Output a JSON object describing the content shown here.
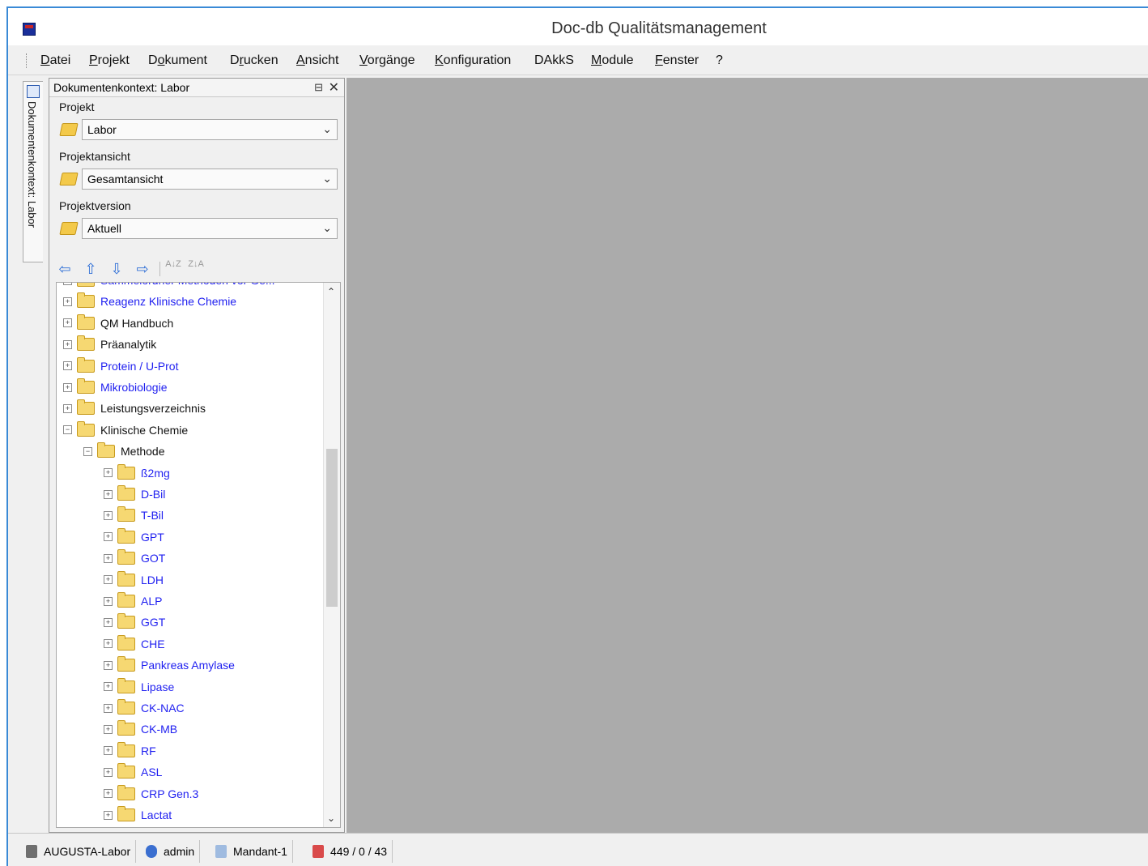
{
  "window": {
    "title": "Doc-db Qualitätsmanagement"
  },
  "menu": [
    {
      "pre": "",
      "mn": "D",
      "post": "atei"
    },
    {
      "pre": "",
      "mn": "P",
      "post": "rojekt"
    },
    {
      "pre": "D",
      "mn": "o",
      "post": "kument"
    },
    {
      "pre": "D",
      "mn": "r",
      "post": "ucken"
    },
    {
      "pre": "",
      "mn": "A",
      "post": "nsicht"
    },
    {
      "pre": "",
      "mn": "V",
      "post": "orgänge"
    },
    {
      "pre": "",
      "mn": "K",
      "post": "onfiguration"
    },
    {
      "pre": "DAkkS",
      "mn": "",
      "post": ""
    },
    {
      "pre": "",
      "mn": "M",
      "post": "odule"
    },
    {
      "pre": "",
      "mn": "F",
      "post": "enster"
    },
    {
      "pre": "?",
      "mn": "",
      "post": ""
    }
  ],
  "side_tab": {
    "label": "Dokumentenkontext: Labor"
  },
  "panel": {
    "title": "Dokumentenkontext: Labor",
    "pin_glyph": "⊟",
    "close_glyph": "✕",
    "projekt": {
      "label": "Projekt",
      "value": "Labor"
    },
    "ansicht": {
      "label": "Projektansicht",
      "value": "Gesamtansicht"
    },
    "version": {
      "label": "Projektversion",
      "value": "Aktuell"
    },
    "toolbar": {
      "back": "⇦",
      "up": "⇧",
      "down": "⇩",
      "forward": "⇨",
      "sort_az": "A↓Z",
      "sort_za": "Z↓A"
    }
  },
  "tree": [
    {
      "label": "Sammelordner Methoden vor Ge...",
      "level": 0,
      "expanded": false,
      "color": "blue"
    },
    {
      "label": "Reagenz Klinische Chemie",
      "level": 0,
      "expanded": false,
      "color": "blue"
    },
    {
      "label": "QM Handbuch",
      "level": 0,
      "expanded": false,
      "color": "dark"
    },
    {
      "label": "Präanalytik",
      "level": 0,
      "expanded": false,
      "color": "dark"
    },
    {
      "label": "Protein / U-Prot",
      "level": 0,
      "expanded": false,
      "color": "blue"
    },
    {
      "label": "Mikrobiologie",
      "level": 0,
      "expanded": false,
      "color": "blue"
    },
    {
      "label": "Leistungsverzeichnis",
      "level": 0,
      "expanded": false,
      "color": "dark"
    },
    {
      "label": "Klinische Chemie",
      "level": 0,
      "expanded": true,
      "color": "dark"
    },
    {
      "label": "Methode",
      "level": 1,
      "expanded": true,
      "color": "dark"
    },
    {
      "label": "ß2mg",
      "level": 2,
      "expanded": false,
      "color": "blue"
    },
    {
      "label": "D-Bil",
      "level": 2,
      "expanded": false,
      "color": "blue"
    },
    {
      "label": "T-Bil",
      "level": 2,
      "expanded": false,
      "color": "blue"
    },
    {
      "label": "GPT",
      "level": 2,
      "expanded": false,
      "color": "blue"
    },
    {
      "label": "GOT",
      "level": 2,
      "expanded": false,
      "color": "blue"
    },
    {
      "label": "LDH",
      "level": 2,
      "expanded": false,
      "color": "blue"
    },
    {
      "label": "ALP",
      "level": 2,
      "expanded": false,
      "color": "blue"
    },
    {
      "label": "GGT",
      "level": 2,
      "expanded": false,
      "color": "blue"
    },
    {
      "label": "CHE",
      "level": 2,
      "expanded": false,
      "color": "blue"
    },
    {
      "label": "Pankreas Amylase",
      "level": 2,
      "expanded": false,
      "color": "blue"
    },
    {
      "label": "Lipase",
      "level": 2,
      "expanded": false,
      "color": "blue"
    },
    {
      "label": "CK-NAC",
      "level": 2,
      "expanded": false,
      "color": "blue"
    },
    {
      "label": "CK-MB",
      "level": 2,
      "expanded": false,
      "color": "blue"
    },
    {
      "label": "RF",
      "level": 2,
      "expanded": false,
      "color": "blue"
    },
    {
      "label": "ASL",
      "level": 2,
      "expanded": false,
      "color": "blue"
    },
    {
      "label": "CRP Gen.3",
      "level": 2,
      "expanded": false,
      "color": "blue"
    },
    {
      "label": "Lactat",
      "level": 2,
      "expanded": false,
      "color": "blue"
    }
  ],
  "status": {
    "server": "AUGUSTA-Labor",
    "user": "admin",
    "mandant": "Mandant-1",
    "counts": "449 / 0 / 43"
  },
  "colors": {
    "blue_link": "#1f1ff0",
    "workspace": "#ababab",
    "window_border": "#3a8ad6"
  }
}
